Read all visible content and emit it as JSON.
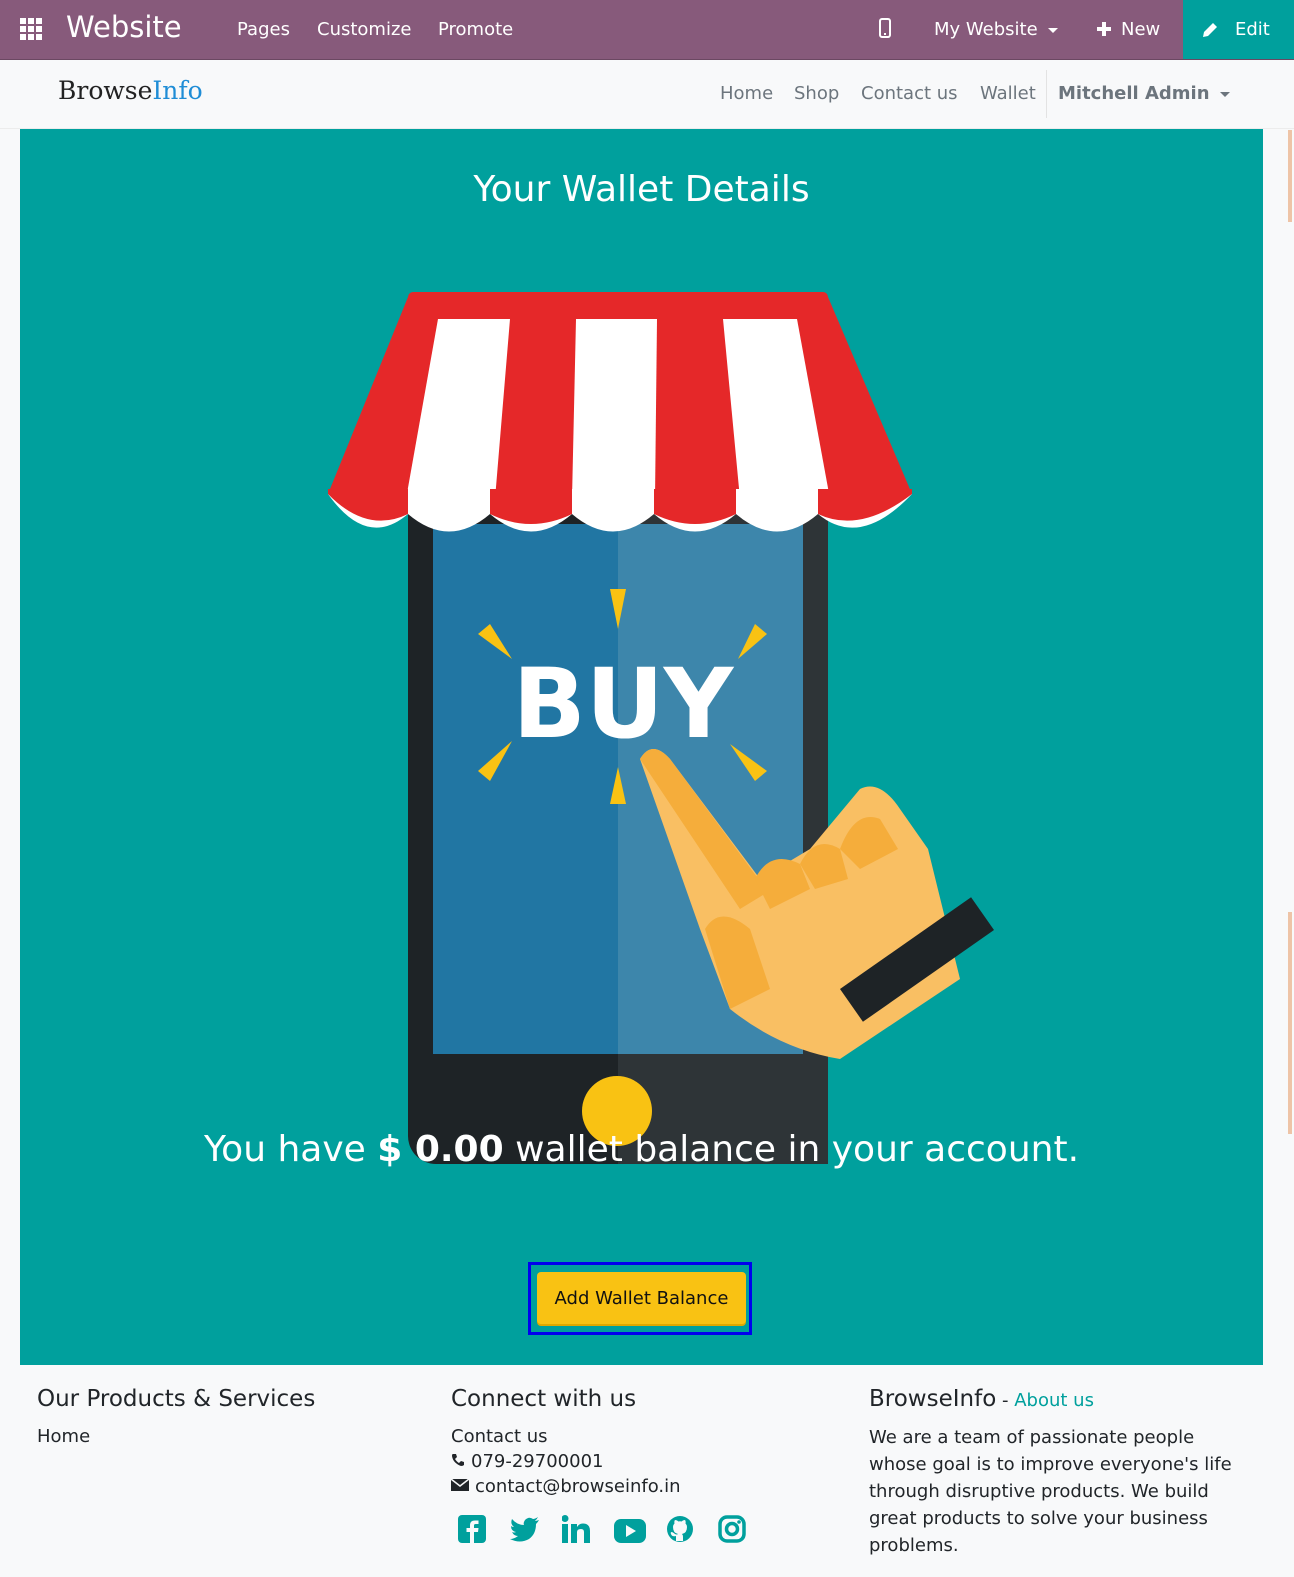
{
  "topbar": {
    "brand": "Website",
    "menu": [
      "Pages",
      "Customize",
      "Promote"
    ],
    "site_selector": "My Website",
    "new_label": "New",
    "edit_label": "Edit",
    "accent": "#875a7b",
    "edit_color": "#00a09d"
  },
  "navbar": {
    "logo_part1": "Browse",
    "logo_part2": "Info",
    "links": [
      "Home",
      "Shop",
      "Contact us",
      "Wallet"
    ],
    "user": "Mitchell Admin"
  },
  "hero": {
    "title": "Your Wallet Details",
    "illustration_text": "BUY",
    "balance_prefix": "You have ",
    "balance_amount": "$ 0.00",
    "balance_suffix": " wallet balance in your account.",
    "button_label": "Add Wallet Balance",
    "bg_color": "#00a09d",
    "button_color": "#f9c213"
  },
  "footer": {
    "col1_title": "Our Products & Services",
    "col1_link": "Home",
    "col2_title": "Connect with us",
    "col2_link": "Contact us",
    "phone": "079-29700001",
    "email": "contact@browseinfo.in",
    "col3_title": "BrowseInfo",
    "col3_sep": " - ",
    "col3_link": "About us",
    "about_text": "We are a team of passionate people whose goal is to improve everyone's life through disruptive products. We build great products to solve your business problems.",
    "social_icons": [
      "facebook-icon",
      "twitter-icon",
      "linkedin-icon",
      "youtube-icon",
      "github-icon",
      "instagram-icon"
    ]
  }
}
